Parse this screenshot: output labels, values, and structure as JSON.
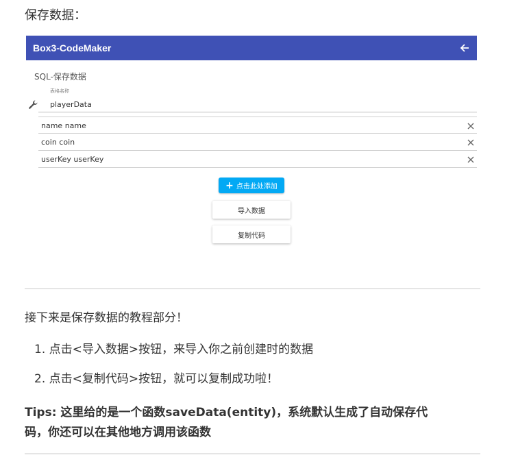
{
  "heading": "保存数据：",
  "app": {
    "title": "Box3-CodeMaker",
    "section_title": "SQL-保存数据",
    "table_label": "表格名称",
    "table_value": "playerData",
    "fields": [
      "name name",
      "coin coin",
      "userKey userKey"
    ],
    "add_button": "点击此处添加",
    "import_button": "导入数据",
    "copy_button": "复制代码",
    "colors": {
      "appbar": "#3f51b5",
      "add_button": "#03a9f4"
    },
    "icons": [
      "back-arrow-icon",
      "wrench-icon",
      "close-icon",
      "plus-icon"
    ]
  },
  "intro": "接下来是保存数据的教程部分！",
  "steps": [
    {
      "num": "1.",
      "text": "点击<导入数据>按钮，来导入你之前创建时的数据"
    },
    {
      "num": "2.",
      "text": "点击<复制代码>按钮，就可以复制成功啦！"
    }
  ],
  "tips_line1": "Tips: 这里给的是一个函数saveData(entity)，系统默认生成了自动保存代",
  "tips_line2": "码，你还可以在其他地方调用该函数"
}
